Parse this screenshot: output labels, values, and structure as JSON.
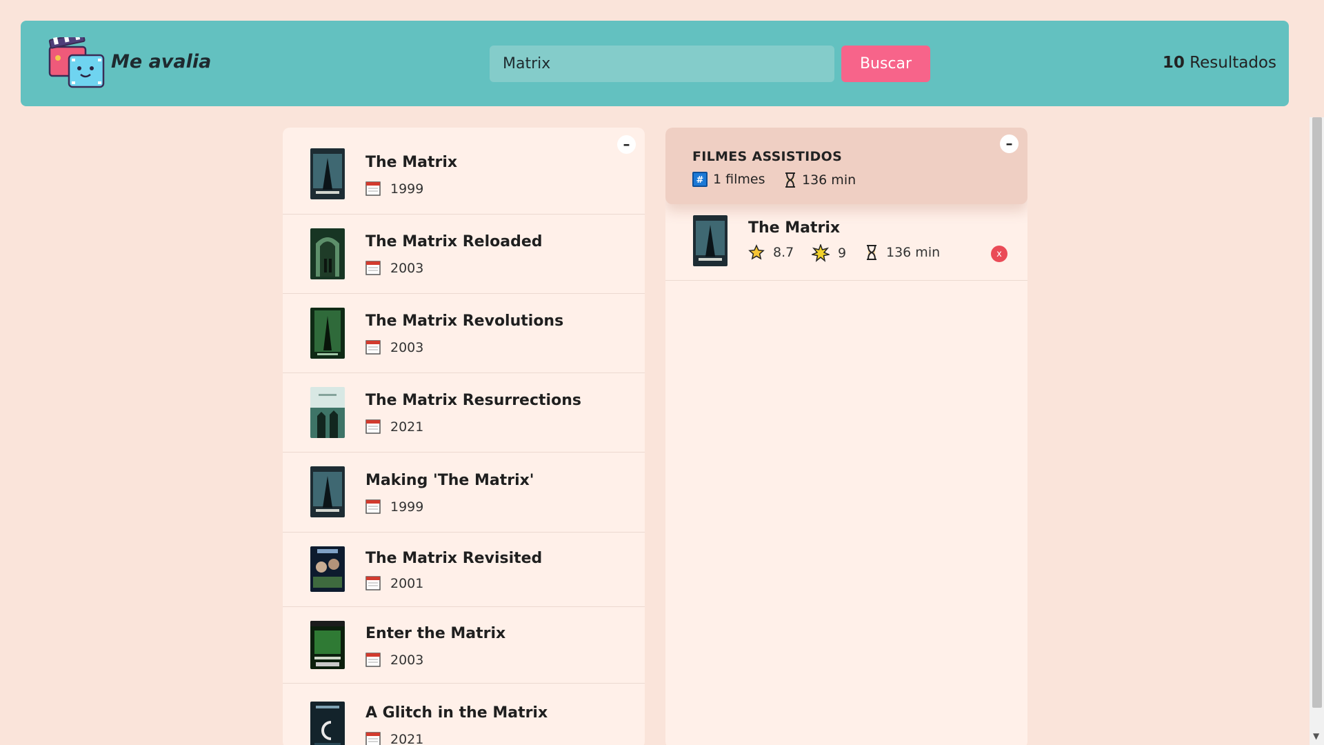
{
  "header": {
    "brand": "Me avalia",
    "search": {
      "value": "Matrix",
      "placeholder": ""
    },
    "search_button": "Buscar",
    "results_count": "10",
    "results_label": "Resultados"
  },
  "search_results": [
    {
      "title": "The Matrix",
      "year": "1999"
    },
    {
      "title": "The Matrix Reloaded",
      "year": "2003"
    },
    {
      "title": "The Matrix Revolutions",
      "year": "2003"
    },
    {
      "title": "The Matrix Resurrections",
      "year": "2021"
    },
    {
      "title": "Making 'The Matrix'",
      "year": "1999"
    },
    {
      "title": "The Matrix Revisited",
      "year": "2001"
    },
    {
      "title": "Enter the Matrix",
      "year": "2003"
    },
    {
      "title": "A Glitch in the Matrix",
      "year": "2021"
    }
  ],
  "watched": {
    "heading": "FILMES ASSISTIDOS",
    "count_label": "1 filmes",
    "runtime_label": "136 min",
    "toggle": "–",
    "items": [
      {
        "title": "The Matrix",
        "imdb_rating": "8.7",
        "user_rating": "9",
        "runtime": "136 min",
        "remove": "x"
      }
    ]
  },
  "results_toggle": "–",
  "colors": {
    "background": "#fae4da",
    "header": "#63c1c0",
    "button": "#f7648a",
    "panel": "#fff0e9",
    "summary": "#efcfc3",
    "remove": "#ea4b57"
  }
}
